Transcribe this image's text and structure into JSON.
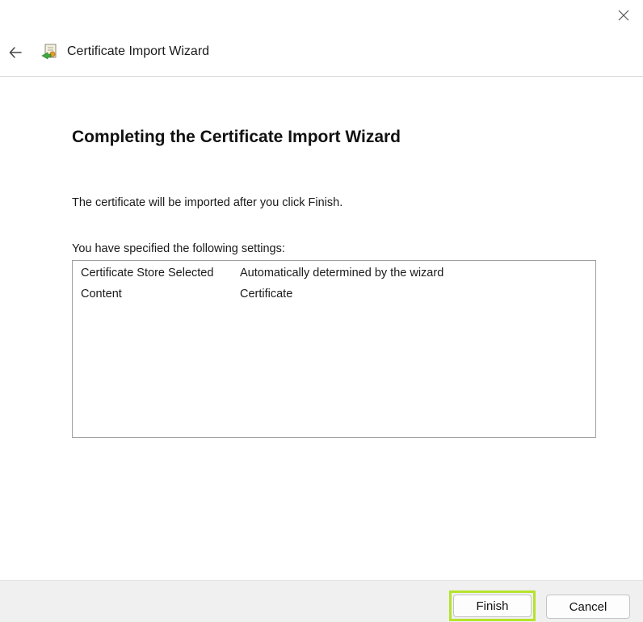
{
  "window": {
    "title": "Certificate Import Wizard"
  },
  "icons": {
    "close": "close-icon",
    "back": "back-arrow-icon",
    "app": "certificate-icon"
  },
  "content": {
    "heading": "Completing the Certificate Import Wizard",
    "info": "The certificate will be imported after you click Finish.",
    "settings_label": "You have specified the following settings:",
    "settings": [
      {
        "key": "Certificate Store Selected",
        "value": "Automatically determined by the wizard"
      },
      {
        "key": "Content",
        "value": "Certificate"
      }
    ]
  },
  "footer": {
    "finish_label": "Finish",
    "cancel_label": "Cancel"
  },
  "colors": {
    "highlight": "#b5e32b",
    "footer_bg": "#f0f0f0",
    "divider": "#d9d9d9"
  }
}
